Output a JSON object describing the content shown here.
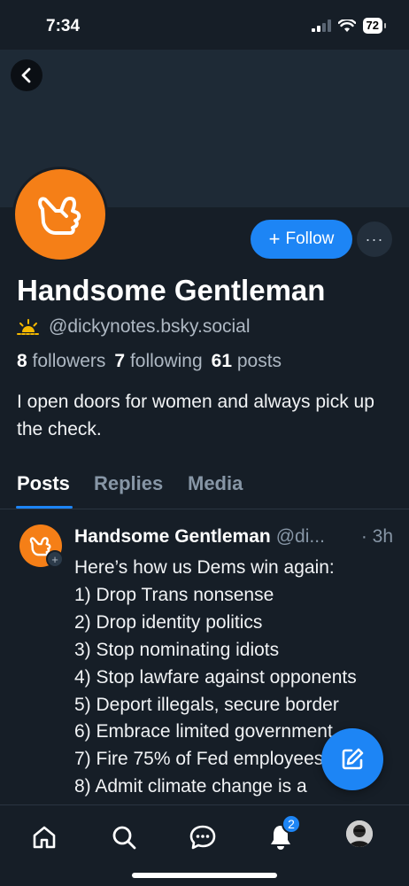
{
  "status_bar": {
    "time": "7:34",
    "battery": "72"
  },
  "profile": {
    "display_name": "Handsome Gentleman",
    "handle": "@dickynotes.bsky.social",
    "followers_count": "8",
    "followers_label": "followers",
    "following_count": "7",
    "following_label": "following",
    "posts_count": "61",
    "posts_label": "posts",
    "bio": "I open doors for women and always pick up the check.",
    "avatar_icon": "shaka-hand-icon",
    "avatar_color": "#f57f17"
  },
  "actions": {
    "follow_label": "Follow",
    "more_label": "···"
  },
  "tabs": [
    {
      "label": "Posts",
      "active": true
    },
    {
      "label": "Replies",
      "active": false
    },
    {
      "label": "Media",
      "active": false
    }
  ],
  "post": {
    "author": "Handsome Gentleman",
    "handle": "@di...",
    "time": "· 3h",
    "lines": [
      "Here’s how us Dems win again:",
      "1) Drop Trans nonsense",
      "2) Drop identity politics",
      "3) Stop nominating idiots",
      "4) Stop lawfare against opponents",
      "5) Deport illegals, secure border",
      "6) Embrace limited government",
      "7) Fire 75% of Fed employees",
      "8) Admit climate change is a"
    ]
  },
  "nav": {
    "notifications_badge": "2"
  },
  "colors": {
    "accent": "#1d85f5",
    "background": "#161e27",
    "banner": "#1e2a36"
  }
}
